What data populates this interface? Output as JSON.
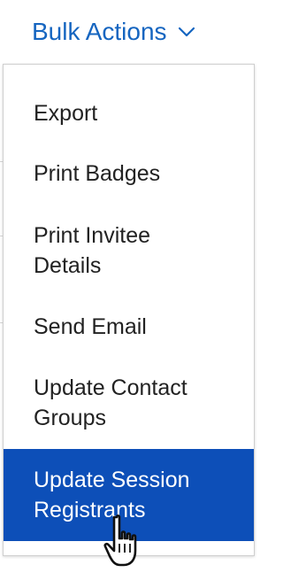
{
  "bulk_actions": {
    "label": "Bulk Actions",
    "icon": "chevron-down-icon",
    "color": "#1565c0"
  },
  "menu": {
    "items": [
      {
        "label": "Export"
      },
      {
        "label": "Print Badges"
      },
      {
        "label": "Print Invitee Details"
      },
      {
        "label": "Send Email"
      },
      {
        "label": "Update Contact Groups"
      },
      {
        "label": "Update Session Registrants",
        "state": "hovered"
      }
    ],
    "highlight_color": "#0d4fb8"
  },
  "cursor": {
    "icon": "hand-pointer-icon"
  }
}
